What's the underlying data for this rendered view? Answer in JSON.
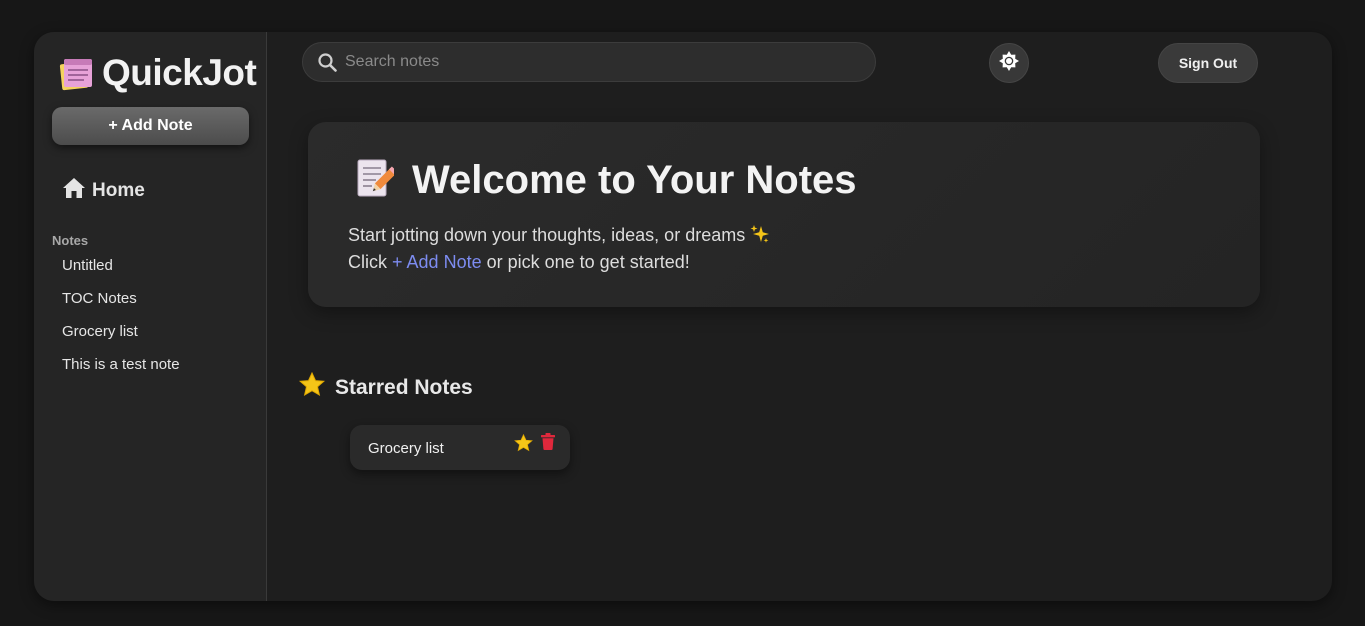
{
  "app": {
    "title": "QuickJot"
  },
  "sidebar": {
    "add_note_label": "+ Add Note",
    "home_label": "Home",
    "notes_heading": "Notes",
    "notes": [
      "Untitled",
      "TOC Notes",
      "Grocery list",
      "This is a test note"
    ]
  },
  "header": {
    "search_placeholder": "Search notes",
    "search_value": "",
    "sign_out_label": "Sign Out"
  },
  "welcome": {
    "title": "Welcome to Your Notes",
    "line1": "Start jotting down your thoughts, ideas, or dreams",
    "line2_prefix": "Click",
    "line2_link": "+ Add Note",
    "line2_suffix": "or pick one to get started!"
  },
  "starred": {
    "heading": "Starred Notes",
    "notes": [
      {
        "title": "Grocery list"
      }
    ]
  },
  "colors": {
    "accent_link": "#7d8cf0",
    "star": "#f5c518",
    "delete": "#e0283c"
  },
  "icons": [
    "notes-logo-icon",
    "home-icon",
    "search-icon",
    "theme-toggle-icon",
    "memo-pencil-icon",
    "sparkles-icon",
    "star-icon",
    "trash-icon"
  ]
}
